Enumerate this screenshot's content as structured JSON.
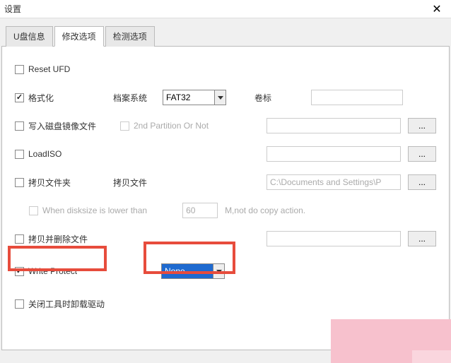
{
  "window": {
    "title": "设置"
  },
  "tabs": [
    {
      "label": "U盘信息"
    },
    {
      "label": "修改选项"
    },
    {
      "label": "检测选项"
    }
  ],
  "options": {
    "reset_ufd": {
      "label": "Reset UFD",
      "checked": false
    },
    "format": {
      "label": "格式化",
      "checked": true,
      "fs_label": "档案系统",
      "fs_value": "FAT32",
      "vol_label": "卷标",
      "vol_value": ""
    },
    "write_image": {
      "label": "写入磁盘镜像文件",
      "checked": false,
      "partition_label": "2nd Partition Or Not",
      "path": "",
      "browse": "..."
    },
    "load_iso": {
      "label": "LoadISO",
      "checked": false,
      "path": "",
      "browse": "..."
    },
    "copy_folder": {
      "label": "拷贝文件夹",
      "checked": false,
      "field_label": "拷贝文件",
      "path": "C:\\Documents and Settings\\P",
      "browse": "..."
    },
    "disksize": {
      "label": "When disksize is lower than",
      "value": "60",
      "suffix": "M,not do copy action."
    },
    "copy_delete": {
      "label": "拷贝并删除文件",
      "checked": false,
      "path": "",
      "browse": "..."
    },
    "write_protect": {
      "label": "Write Protect",
      "checked": true,
      "value": "None"
    },
    "unload_driver": {
      "label": "关闭工具时卸载驱动",
      "checked": false
    }
  }
}
